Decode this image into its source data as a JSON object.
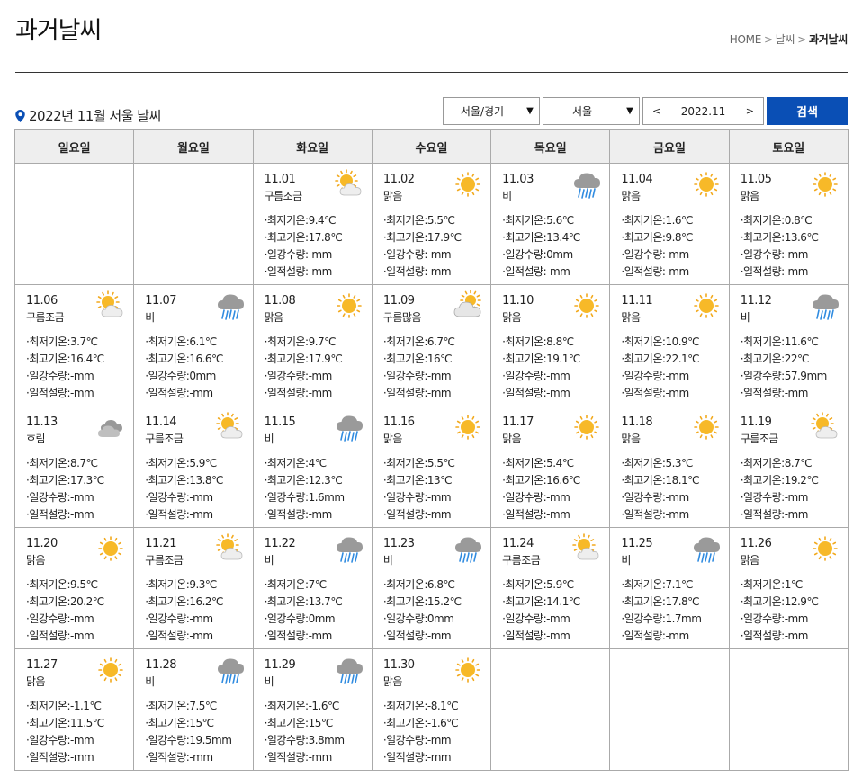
{
  "header": {
    "title": "과거날씨",
    "breadcrumb": {
      "home": "HOME",
      "sep1": ">",
      "level1": "날씨",
      "sep2": ">",
      "current": "과거날씨"
    }
  },
  "filter": {
    "month_title": "2022년 11월 서울 날씨",
    "region": "서울/경기",
    "city": "서울",
    "month": "2022.11",
    "prev": "<",
    "next": ">",
    "search_label": "검색"
  },
  "weekdays": [
    "일요일",
    "월요일",
    "화요일",
    "수요일",
    "목요일",
    "금요일",
    "토요일"
  ],
  "labels": {
    "min": "·최저기온:",
    "max": "·최고기온:",
    "rain": "·일강수량:",
    "snow": "·일적설량:"
  },
  "days": [
    {
      "date": "11.01",
      "cond": "구름조금",
      "icon": "partly-cloudy",
      "min": "9.4℃",
      "max": "17.8℃",
      "rain": "-mm",
      "snow": "-mm"
    },
    {
      "date": "11.02",
      "cond": "맑음",
      "icon": "sun",
      "min": "5.5℃",
      "max": "17.9℃",
      "rain": "-mm",
      "snow": "-mm"
    },
    {
      "date": "11.03",
      "cond": "비",
      "icon": "rain",
      "min": "5.6℃",
      "max": "13.4℃",
      "rain": "0mm",
      "snow": "-mm"
    },
    {
      "date": "11.04",
      "cond": "맑음",
      "icon": "sun",
      "min": "1.6℃",
      "max": "9.8℃",
      "rain": "-mm",
      "snow": "-mm"
    },
    {
      "date": "11.05",
      "cond": "맑음",
      "icon": "sun",
      "min": "0.8℃",
      "max": "13.6℃",
      "rain": "-mm",
      "snow": "-mm"
    },
    {
      "date": "11.06",
      "cond": "구름조금",
      "icon": "partly-cloudy",
      "min": "3.7℃",
      "max": "16.4℃",
      "rain": "-mm",
      "snow": "-mm"
    },
    {
      "date": "11.07",
      "cond": "비",
      "icon": "rain",
      "min": "6.1℃",
      "max": "16.6℃",
      "rain": "0mm",
      "snow": "-mm"
    },
    {
      "date": "11.08",
      "cond": "맑음",
      "icon": "sun",
      "min": "9.7℃",
      "max": "17.9℃",
      "rain": "-mm",
      "snow": "-mm"
    },
    {
      "date": "11.09",
      "cond": "구름많음",
      "icon": "mostly-cloudy",
      "min": "6.7℃",
      "max": "16℃",
      "rain": "-mm",
      "snow": "-mm"
    },
    {
      "date": "11.10",
      "cond": "맑음",
      "icon": "sun",
      "min": "8.8℃",
      "max": "19.1℃",
      "rain": "-mm",
      "snow": "-mm"
    },
    {
      "date": "11.11",
      "cond": "맑음",
      "icon": "sun",
      "min": "10.9℃",
      "max": "22.1℃",
      "rain": "-mm",
      "snow": "-mm"
    },
    {
      "date": "11.12",
      "cond": "비",
      "icon": "rain",
      "min": "11.6℃",
      "max": "22℃",
      "rain": "57.9mm",
      "snow": "-mm"
    },
    {
      "date": "11.13",
      "cond": "흐림",
      "icon": "cloudy",
      "min": "8.7℃",
      "max": "17.3℃",
      "rain": "-mm",
      "snow": "-mm"
    },
    {
      "date": "11.14",
      "cond": "구름조금",
      "icon": "partly-cloudy",
      "min": "5.9℃",
      "max": "13.8℃",
      "rain": "-mm",
      "snow": "-mm"
    },
    {
      "date": "11.15",
      "cond": "비",
      "icon": "rain",
      "min": "4℃",
      "max": "12.3℃",
      "rain": "1.6mm",
      "snow": "-mm"
    },
    {
      "date": "11.16",
      "cond": "맑음",
      "icon": "sun",
      "min": "5.5℃",
      "max": "13℃",
      "rain": "-mm",
      "snow": "-mm"
    },
    {
      "date": "11.17",
      "cond": "맑음",
      "icon": "sun",
      "min": "5.4℃",
      "max": "16.6℃",
      "rain": "-mm",
      "snow": "-mm"
    },
    {
      "date": "11.18",
      "cond": "맑음",
      "icon": "sun",
      "min": "5.3℃",
      "max": "18.1℃",
      "rain": "-mm",
      "snow": "-mm"
    },
    {
      "date": "11.19",
      "cond": "구름조금",
      "icon": "partly-cloudy",
      "min": "8.7℃",
      "max": "19.2℃",
      "rain": "-mm",
      "snow": "-mm"
    },
    {
      "date": "11.20",
      "cond": "맑음",
      "icon": "sun",
      "min": "9.5℃",
      "max": "20.2℃",
      "rain": "-mm",
      "snow": "-mm"
    },
    {
      "date": "11.21",
      "cond": "구름조금",
      "icon": "partly-cloudy",
      "min": "9.3℃",
      "max": "16.2℃",
      "rain": "-mm",
      "snow": "-mm"
    },
    {
      "date": "11.22",
      "cond": "비",
      "icon": "rain",
      "min": "7℃",
      "max": "13.7℃",
      "rain": "0mm",
      "snow": "-mm"
    },
    {
      "date": "11.23",
      "cond": "비",
      "icon": "rain",
      "min": "6.8℃",
      "max": "15.2℃",
      "rain": "0mm",
      "snow": "-mm"
    },
    {
      "date": "11.24",
      "cond": "구름조금",
      "icon": "partly-cloudy",
      "min": "5.9℃",
      "max": "14.1℃",
      "rain": "-mm",
      "snow": "-mm"
    },
    {
      "date": "11.25",
      "cond": "비",
      "icon": "rain",
      "min": "7.1℃",
      "max": "17.8℃",
      "rain": "1.7mm",
      "snow": "-mm"
    },
    {
      "date": "11.26",
      "cond": "맑음",
      "icon": "sun",
      "min": "1℃",
      "max": "12.9℃",
      "rain": "-mm",
      "snow": "-mm"
    },
    {
      "date": "11.27",
      "cond": "맑음",
      "icon": "sun",
      "min": "-1.1℃",
      "max": "11.5℃",
      "rain": "-mm",
      "snow": "-mm"
    },
    {
      "date": "11.28",
      "cond": "비",
      "icon": "rain",
      "min": "7.5℃",
      "max": "15℃",
      "rain": "19.5mm",
      "snow": "-mm"
    },
    {
      "date": "11.29",
      "cond": "비",
      "icon": "rain",
      "min": "-1.6℃",
      "max": "15℃",
      "rain": "3.8mm",
      "snow": "-mm"
    },
    {
      "date": "11.30",
      "cond": "맑음",
      "icon": "sun",
      "min": "-8.1℃",
      "max": "-1.6℃",
      "rain": "-mm",
      "snow": "-mm"
    }
  ]
}
